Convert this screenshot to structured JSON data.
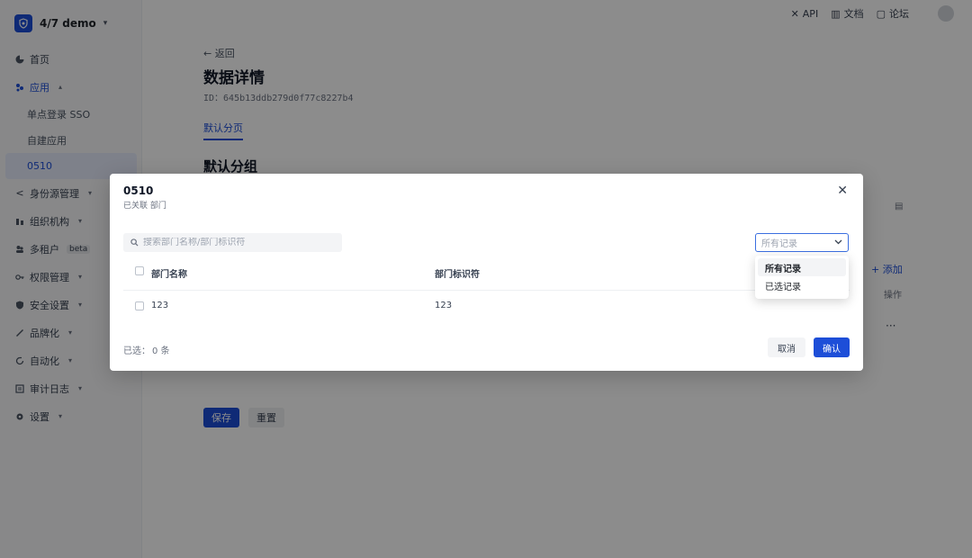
{
  "brand": {
    "name": "4/7 demo"
  },
  "header": {
    "links": [
      "API",
      "文档",
      "论坛"
    ]
  },
  "sidebar": {
    "items": [
      {
        "label": "首页"
      },
      {
        "label": "应用"
      },
      {
        "label": "身份源管理"
      },
      {
        "label": "组织机构"
      },
      {
        "label": "多租户",
        "badge": "beta"
      },
      {
        "label": "权限管理"
      },
      {
        "label": "安全设置"
      },
      {
        "label": "品牌化"
      },
      {
        "label": "自动化"
      },
      {
        "label": "审计日志"
      },
      {
        "label": "设置"
      }
    ],
    "sub_items": [
      "单点登录 SSO",
      "自建应用",
      "0510"
    ]
  },
  "main": {
    "back": "← 返回",
    "title": "数据详情",
    "id_line": "ID：645b13ddb279d0f77c8227b4",
    "tab": "默认分页",
    "section_title": "默认分组",
    "add_label": "+ 添加",
    "operation_label": "操作",
    "more": "···",
    "save": "保存",
    "reset": "重置"
  },
  "modal": {
    "title": "0510",
    "subtitle": "已关联 部门",
    "search_placeholder": "搜索部门名称/部门标识符",
    "filter_value": "所有记录",
    "columns": [
      "部门名称",
      "部门标识符"
    ],
    "rows": [
      {
        "name": "123",
        "code": "123"
      }
    ],
    "selected_label": "已选：",
    "selected_count": "0 条",
    "cancel": "取消",
    "confirm": "确认"
  },
  "dropdown": {
    "options": [
      "所有记录",
      "已选记录"
    ]
  },
  "colors": {
    "primary": "#1d4ed8",
    "overlay": "rgba(0,0,0,0.45)"
  }
}
